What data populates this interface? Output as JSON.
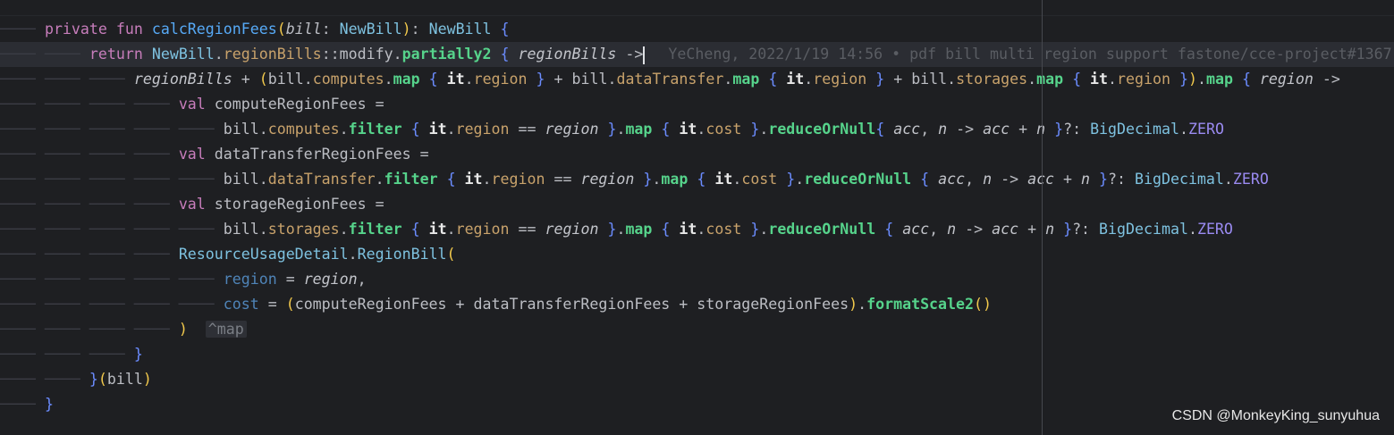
{
  "editor": {
    "lines": [
      {
        "indent": 1,
        "tokens": [
          [
            "kw",
            "private fun "
          ],
          [
            "fn",
            "calcRegionFees"
          ],
          [
            "paren",
            "("
          ],
          [
            "param",
            "bill"
          ],
          [
            "op",
            ": "
          ],
          [
            "type",
            "NewBill"
          ],
          [
            "paren",
            ")"
          ],
          [
            "op",
            ": "
          ],
          [
            "type",
            "NewBill "
          ],
          [
            "brace",
            "{"
          ]
        ]
      },
      {
        "indent": 2,
        "current": true,
        "tokens": [
          [
            "kw",
            "return "
          ],
          [
            "type",
            "NewBill"
          ],
          [
            "op",
            "."
          ],
          [
            "prop",
            "regionBills"
          ],
          [
            "op",
            "::"
          ],
          [
            "plain",
            "modify"
          ],
          [
            "op",
            "."
          ],
          [
            "call",
            "partially2 "
          ],
          [
            "brace",
            "{ "
          ],
          [
            "ital",
            "regionBills "
          ],
          [
            "op",
            "->"
          ],
          [
            "caret",
            ""
          ],
          [
            "blame",
            "YeCheng, 2022/1/19 14:56 • pdf bill multi region support fastone/cce-project#1367"
          ]
        ]
      },
      {
        "indent": 3,
        "tokens": [
          [
            "ital",
            "regionBills "
          ],
          [
            "op",
            "+ "
          ],
          [
            "paren",
            "("
          ],
          [
            "plain",
            "bill"
          ],
          [
            "op",
            "."
          ],
          [
            "prop",
            "computes"
          ],
          [
            "op",
            "."
          ],
          [
            "call",
            "map "
          ],
          [
            "brace",
            "{ "
          ],
          [
            "it",
            "it"
          ],
          [
            "op",
            "."
          ],
          [
            "prop",
            "region "
          ],
          [
            "brace",
            "} "
          ],
          [
            "op",
            "+ "
          ],
          [
            "plain",
            "bill"
          ],
          [
            "op",
            "."
          ],
          [
            "prop",
            "dataTransfer"
          ],
          [
            "op",
            "."
          ],
          [
            "call",
            "map "
          ],
          [
            "brace",
            "{ "
          ],
          [
            "it",
            "it"
          ],
          [
            "op",
            "."
          ],
          [
            "prop",
            "region "
          ],
          [
            "brace",
            "} "
          ],
          [
            "op",
            "+ "
          ],
          [
            "plain",
            "bill"
          ],
          [
            "op",
            "."
          ],
          [
            "prop",
            "storages"
          ],
          [
            "op",
            "."
          ],
          [
            "call",
            "map "
          ],
          [
            "brace",
            "{ "
          ],
          [
            "it",
            "it"
          ],
          [
            "op",
            "."
          ],
          [
            "prop",
            "region "
          ],
          [
            "brace",
            "}"
          ],
          [
            "paren",
            ")"
          ],
          [
            "op",
            "."
          ],
          [
            "call",
            "map "
          ],
          [
            "brace",
            "{ "
          ],
          [
            "ital",
            "region "
          ],
          [
            "op",
            "->"
          ]
        ]
      },
      {
        "indent": 4,
        "tokens": [
          [
            "kw",
            "val "
          ],
          [
            "plain",
            "computeRegionFees "
          ],
          [
            "op",
            "="
          ]
        ]
      },
      {
        "indent": 5,
        "tokens": [
          [
            "plain",
            "bill"
          ],
          [
            "op",
            "."
          ],
          [
            "prop",
            "computes"
          ],
          [
            "op",
            "."
          ],
          [
            "call",
            "filter "
          ],
          [
            "brace",
            "{ "
          ],
          [
            "it",
            "it"
          ],
          [
            "op",
            "."
          ],
          [
            "prop",
            "region "
          ],
          [
            "op",
            "== "
          ],
          [
            "ital",
            "region "
          ],
          [
            "brace",
            "}"
          ],
          [
            "op",
            "."
          ],
          [
            "call",
            "map "
          ],
          [
            "brace",
            "{ "
          ],
          [
            "it",
            "it"
          ],
          [
            "op",
            "."
          ],
          [
            "prop",
            "cost "
          ],
          [
            "brace",
            "}"
          ],
          [
            "op",
            "."
          ],
          [
            "call",
            "reduceOrNull"
          ],
          [
            "brace",
            "{ "
          ],
          [
            "ital",
            "acc"
          ],
          [
            "op",
            ", "
          ],
          [
            "ital",
            "n "
          ],
          [
            "op",
            "-> "
          ],
          [
            "ital",
            "acc "
          ],
          [
            "op",
            "+ "
          ],
          [
            "ital",
            "n "
          ],
          [
            "brace",
            "}"
          ],
          [
            "op",
            "?: "
          ],
          [
            "type",
            "BigDecimal"
          ],
          [
            "op",
            "."
          ],
          [
            "const",
            "ZERO"
          ]
        ]
      },
      {
        "indent": 4,
        "tokens": [
          [
            "kw",
            "val "
          ],
          [
            "plain",
            "dataTransferRegionFees "
          ],
          [
            "op",
            "="
          ]
        ]
      },
      {
        "indent": 5,
        "tokens": [
          [
            "plain",
            "bill"
          ],
          [
            "op",
            "."
          ],
          [
            "prop",
            "dataTransfer"
          ],
          [
            "op",
            "."
          ],
          [
            "call",
            "filter "
          ],
          [
            "brace",
            "{ "
          ],
          [
            "it",
            "it"
          ],
          [
            "op",
            "."
          ],
          [
            "prop",
            "region "
          ],
          [
            "op",
            "== "
          ],
          [
            "ital",
            "region "
          ],
          [
            "brace",
            "}"
          ],
          [
            "op",
            "."
          ],
          [
            "call",
            "map "
          ],
          [
            "brace",
            "{ "
          ],
          [
            "it",
            "it"
          ],
          [
            "op",
            "."
          ],
          [
            "prop",
            "cost "
          ],
          [
            "brace",
            "}"
          ],
          [
            "op",
            "."
          ],
          [
            "call",
            "reduceOrNull "
          ],
          [
            "brace",
            "{ "
          ],
          [
            "ital",
            "acc"
          ],
          [
            "op",
            ", "
          ],
          [
            "ital",
            "n "
          ],
          [
            "op",
            "-> "
          ],
          [
            "ital",
            "acc "
          ],
          [
            "op",
            "+ "
          ],
          [
            "ital",
            "n "
          ],
          [
            "brace",
            "}"
          ],
          [
            "op",
            "?: "
          ],
          [
            "type",
            "BigDecimal"
          ],
          [
            "op",
            "."
          ],
          [
            "const",
            "ZERO"
          ]
        ]
      },
      {
        "indent": 4,
        "tokens": [
          [
            "kw",
            "val "
          ],
          [
            "plain",
            "storageRegionFees "
          ],
          [
            "op",
            "="
          ]
        ]
      },
      {
        "indent": 5,
        "tokens": [
          [
            "plain",
            "bill"
          ],
          [
            "op",
            "."
          ],
          [
            "prop",
            "storages"
          ],
          [
            "op",
            "."
          ],
          [
            "call",
            "filter "
          ],
          [
            "brace",
            "{ "
          ],
          [
            "it",
            "it"
          ],
          [
            "op",
            "."
          ],
          [
            "prop",
            "region "
          ],
          [
            "op",
            "== "
          ],
          [
            "ital",
            "region "
          ],
          [
            "brace",
            "}"
          ],
          [
            "op",
            "."
          ],
          [
            "call",
            "map "
          ],
          [
            "brace",
            "{ "
          ],
          [
            "it",
            "it"
          ],
          [
            "op",
            "."
          ],
          [
            "prop",
            "cost "
          ],
          [
            "brace",
            "}"
          ],
          [
            "op",
            "."
          ],
          [
            "call",
            "reduceOrNull "
          ],
          [
            "brace",
            "{ "
          ],
          [
            "ital",
            "acc"
          ],
          [
            "op",
            ", "
          ],
          [
            "ital",
            "n "
          ],
          [
            "op",
            "-> "
          ],
          [
            "ital",
            "acc "
          ],
          [
            "op",
            "+ "
          ],
          [
            "ital",
            "n "
          ],
          [
            "brace",
            "}"
          ],
          [
            "op",
            "?: "
          ],
          [
            "type",
            "BigDecimal"
          ],
          [
            "op",
            "."
          ],
          [
            "const",
            "ZERO"
          ]
        ]
      },
      {
        "indent": 4,
        "tokens": [
          [
            "type",
            "ResourceUsageDetail"
          ],
          [
            "op",
            "."
          ],
          [
            "type",
            "RegionBill"
          ],
          [
            "paren",
            "("
          ]
        ]
      },
      {
        "indent": 5,
        "tokens": [
          [
            "named",
            "region "
          ],
          [
            "op",
            "= "
          ],
          [
            "ital",
            "region"
          ],
          [
            "op",
            ","
          ]
        ]
      },
      {
        "indent": 5,
        "tokens": [
          [
            "named",
            "cost "
          ],
          [
            "op",
            "= "
          ],
          [
            "paren",
            "("
          ],
          [
            "plain",
            "computeRegionFees "
          ],
          [
            "op",
            "+ "
          ],
          [
            "plain",
            "dataTransferRegionFees "
          ],
          [
            "op",
            "+ "
          ],
          [
            "plain",
            "storageRegionFees"
          ],
          [
            "paren",
            ")"
          ],
          [
            "op",
            "."
          ],
          [
            "call",
            "formatScale2"
          ],
          [
            "paren",
            "()"
          ]
        ]
      },
      {
        "indent": 4,
        "tokens": [
          [
            "paren",
            ")"
          ],
          [
            "plain",
            "  "
          ],
          [
            "tag",
            "^map"
          ]
        ]
      },
      {
        "indent": 3,
        "tokens": [
          [
            "brace",
            "}"
          ]
        ]
      },
      {
        "indent": 2,
        "tokens": [
          [
            "brace",
            "}"
          ],
          [
            "paren",
            "("
          ],
          [
            "plain",
            "bill"
          ],
          [
            "paren",
            ")"
          ]
        ]
      },
      {
        "indent": 1,
        "tokens": [
          [
            "brace",
            "}"
          ]
        ]
      }
    ]
  },
  "watermark": "CSDN @MonkeyKing_sunyuhua"
}
